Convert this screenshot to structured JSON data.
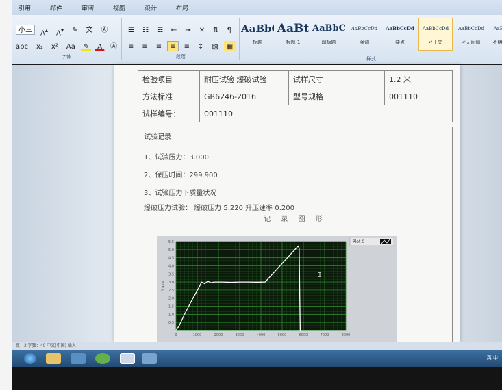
{
  "ribbon": {
    "tabs": [
      "引用",
      "邮件",
      "审阅",
      "视图",
      "设计",
      "布局"
    ],
    "font_size_value": "小三",
    "group_labels": {
      "font": "字体",
      "paragraph": "段落",
      "styles": "样式"
    },
    "styles": [
      {
        "sample": "AaBbC(",
        "name": "标题"
      },
      {
        "sample": "AaBt",
        "name": "标题 1"
      },
      {
        "sample": "AaBbC(",
        "name": "副标题"
      },
      {
        "sample": "AaBbCcDd",
        "name": "强调"
      },
      {
        "sample": "AaBbCcDd",
        "name": "要点"
      },
      {
        "sample": "AaBbCcDd",
        "name": "↵正文"
      },
      {
        "sample": "AaBbCcDd",
        "name": "↵无间隔"
      },
      {
        "sample": "AaBb",
        "name": "不明显"
      }
    ]
  },
  "form": {
    "row1": {
      "label1": "检验项目",
      "value1": "耐压试验 爆破试验",
      "label2": "试样尺寸",
      "value2": "1.2 米"
    },
    "row2": {
      "label1": "方法标准",
      "value1": "GB6246-2016",
      "label2": "型号规格",
      "value2": "001110"
    },
    "row3": {
      "label1": "试样编号：",
      "value1": "001110"
    }
  },
  "record": {
    "heading": "试验记录",
    "line1": "1、试验压力：3.000",
    "line2": "2、保压时间：299.900",
    "line3": "3、试验压力下质量状况",
    "line4": "爆破压力试验：   爆破压力 5.220   升压速率 0.200",
    "chart_heading": "记 录 图 形"
  },
  "chart_data": {
    "type": "line",
    "legend": "Plot 0",
    "ylabel": "Y axis",
    "xlabel": "",
    "xlim": [
      0,
      8000
    ],
    "ylim": [
      0,
      5.5
    ],
    "x_ticks": [
      0,
      1000,
      2000,
      3000,
      4000,
      5000,
      6000,
      7000,
      8000
    ],
    "y_ticks": [
      0.5,
      1.0,
      1.5,
      2.0,
      2.5,
      3.0,
      3.5,
      4.0,
      4.5,
      5.0,
      5.5
    ],
    "series": [
      {
        "x": [
          0,
          150,
          400,
          800,
          1100,
          1200,
          1350,
          1500,
          1650,
          1800,
          2200,
          2600,
          3000,
          3400,
          3800,
          4200,
          5600,
          5750,
          5800,
          5850,
          5900
        ],
        "y": [
          0.0,
          0.3,
          1.0,
          2.0,
          2.7,
          3.0,
          2.9,
          3.05,
          2.95,
          3.0,
          3.0,
          2.98,
          3.0,
          3.0,
          2.99,
          3.0,
          5.0,
          5.22,
          5.1,
          0.0,
          0.0
        ]
      }
    ],
    "background": "#0b1a0b",
    "grid_color": "#2f8a2f",
    "line_color": "#ffffff"
  },
  "status": {
    "text": "页：2   字数：40   中文(中国)   插入",
    "tray": "英 中"
  }
}
